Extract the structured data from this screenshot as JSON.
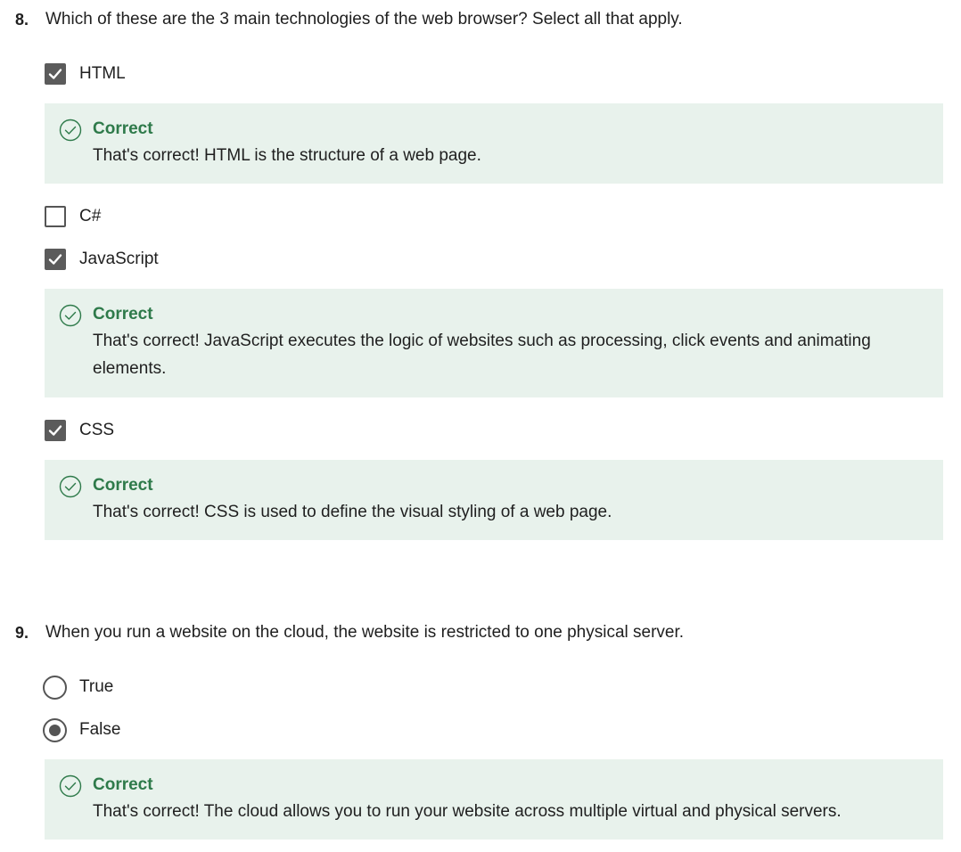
{
  "questions": [
    {
      "number": "8.",
      "text": "Which of these are the 3 main technologies of the web browser? Select all that apply.",
      "type": "checkbox",
      "options": [
        {
          "label": "HTML",
          "checked": true,
          "feedback": {
            "title": "Correct",
            "text": "That's correct! HTML is the structure of a web page."
          }
        },
        {
          "label": "C#",
          "checked": false
        },
        {
          "label": "JavaScript",
          "checked": true,
          "feedback": {
            "title": "Correct",
            "text": "That's correct! JavaScript executes the logic of websites such as processing, click events and animating elements."
          }
        },
        {
          "label": "CSS",
          "checked": true,
          "feedback": {
            "title": "Correct",
            "text": "That's correct! CSS is used to define the visual styling of a web page."
          }
        }
      ]
    },
    {
      "number": "9.",
      "text": "When you run a website on the cloud, the website is restricted to one physical server.",
      "type": "radio",
      "options": [
        {
          "label": "True",
          "selected": false
        },
        {
          "label": "False",
          "selected": true
        }
      ],
      "feedback": {
        "title": "Correct",
        "text": "That's correct! The cloud allows you to run your website across multiple virtual and physical servers."
      }
    }
  ],
  "colors": {
    "correct_green": "#2e7a4a",
    "feedback_bg": "#e8f2ec",
    "control_gray": "#5b5b5b"
  }
}
